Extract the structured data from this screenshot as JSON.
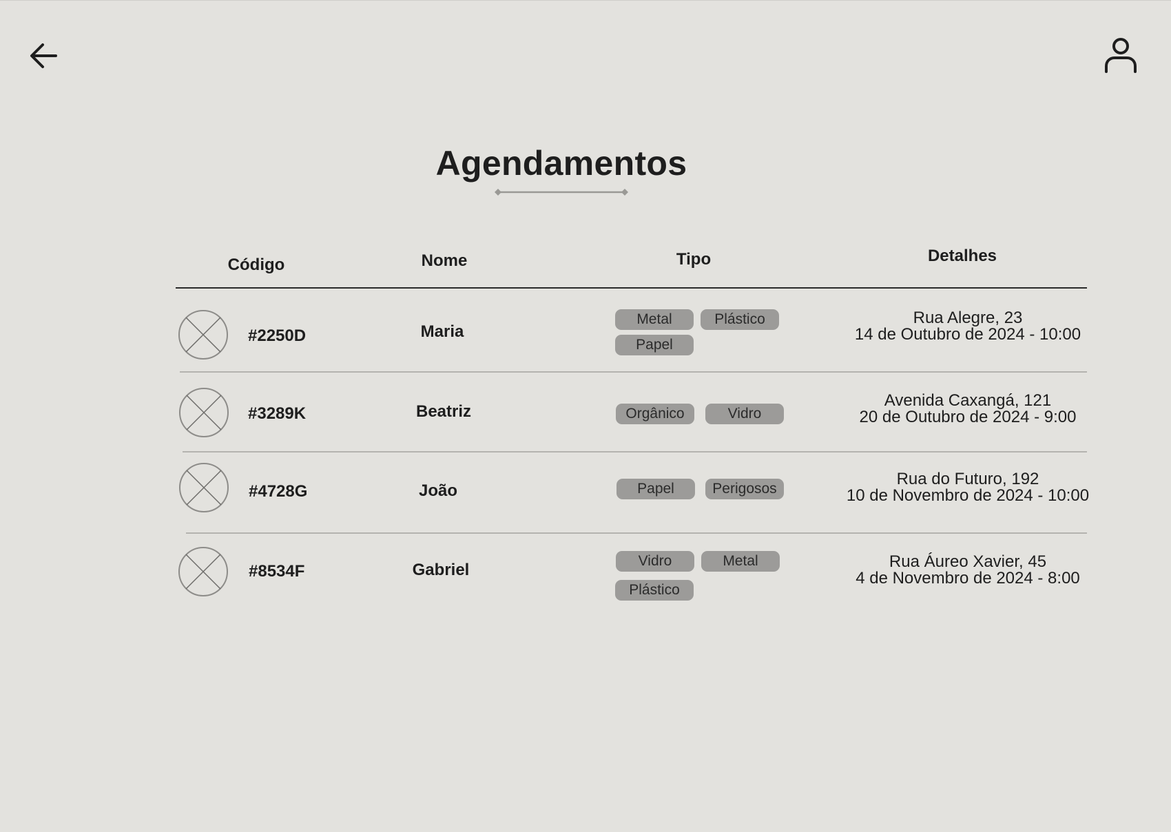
{
  "title": "Agendamentos",
  "header": {
    "back_icon": "arrow-left-icon",
    "profile_icon": "user-icon"
  },
  "table": {
    "columns": {
      "code": "Código",
      "name": "Nome",
      "type": "Tipo",
      "details": "Detalhes"
    },
    "rows": [
      {
        "code": "#2250D",
        "name": "Maria",
        "tags": [
          "Metal",
          "Plástico",
          "Papel"
        ],
        "address": "Rua Alegre, 23",
        "datetime": "14 de Outubro de 2024 - 10:00"
      },
      {
        "code": "#3289K",
        "name": "Beatriz",
        "tags": [
          "Orgânico",
          "Vidro"
        ],
        "address": "Avenida Caxangá, 121",
        "datetime": "20 de Outubro de 2024 - 9:00"
      },
      {
        "code": "#4728G",
        "name": "João",
        "tags": [
          "Papel",
          "Perigosos"
        ],
        "address": "Rua do Futuro, 192",
        "datetime": "10 de Novembro de 2024 - 10:00"
      },
      {
        "code": "#8534F",
        "name": "Gabriel",
        "tags": [
          "Vidro",
          "Metal",
          "Plástico"
        ],
        "address": "Rua Áureo Xavier, 45",
        "datetime": "4 de Novembro de 2024 - 8:00"
      }
    ]
  },
  "colors": {
    "background": "#e3e2de",
    "tag_background": "#9c9b99",
    "text": "#1e1e1e",
    "divider": "#b4b3af"
  }
}
